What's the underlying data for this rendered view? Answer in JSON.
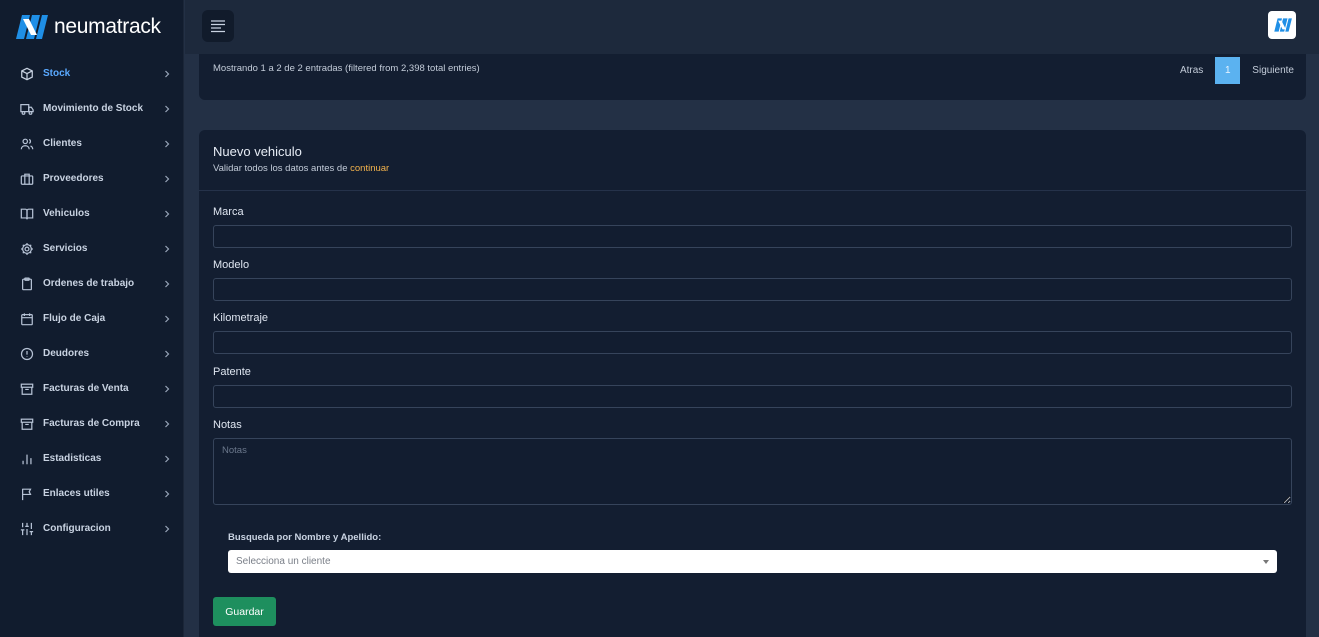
{
  "brand": {
    "name": "neumatrack"
  },
  "sidebar": {
    "items": [
      {
        "label": "Stock",
        "icon": "cube-icon"
      },
      {
        "label": "Movimiento de Stock",
        "icon": "truck-icon"
      },
      {
        "label": "Clientes",
        "icon": "users-icon"
      },
      {
        "label": "Proveedores",
        "icon": "briefcase-icon"
      },
      {
        "label": "Vehiculos",
        "icon": "book-icon"
      },
      {
        "label": "Servicios",
        "icon": "gear-icon"
      },
      {
        "label": "Ordenes de trabajo",
        "icon": "clipboard-icon"
      },
      {
        "label": "Flujo de Caja",
        "icon": "calendar-icon"
      },
      {
        "label": "Deudores",
        "icon": "alert-circle-icon"
      },
      {
        "label": "Facturas de Venta",
        "icon": "archive-icon"
      },
      {
        "label": "Facturas de Compra",
        "icon": "archive-icon"
      },
      {
        "label": "Estadisticas",
        "icon": "bar-chart-icon"
      },
      {
        "label": "Enlaces utiles",
        "icon": "flag-icon"
      },
      {
        "label": "Configuracion",
        "icon": "sliders-icon"
      }
    ],
    "active": "Stock"
  },
  "table_footer": {
    "info": "Mostrando 1 a 2 de 2 entradas (filtered from 2,398 total entries)",
    "prev": "Atras",
    "page": "1",
    "next": "Siguiente"
  },
  "form": {
    "title": "Nuevo vehiculo",
    "subtitle": "Validar todos los datos antes de",
    "subtitle_link": "continuar",
    "fields": {
      "marca": {
        "label": "Marca",
        "value": ""
      },
      "modelo": {
        "label": "Modelo",
        "value": ""
      },
      "kilometraje": {
        "label": "Kilometraje",
        "value": ""
      },
      "patente": {
        "label": "Patente",
        "value": ""
      },
      "notas": {
        "label": "Notas",
        "placeholder": "Notas"
      }
    },
    "search_label": "Busqueda por Nombre y Apellido:",
    "client_select": "Selecciona un cliente",
    "save": "Guardar"
  },
  "colors": {
    "background": "#233045",
    "sidebar": "#111c2e",
    "card": "#131e31",
    "accent_blue": "#5aa9ff",
    "link_orange": "#f2b24c",
    "save_green": "#1e8f5e"
  }
}
